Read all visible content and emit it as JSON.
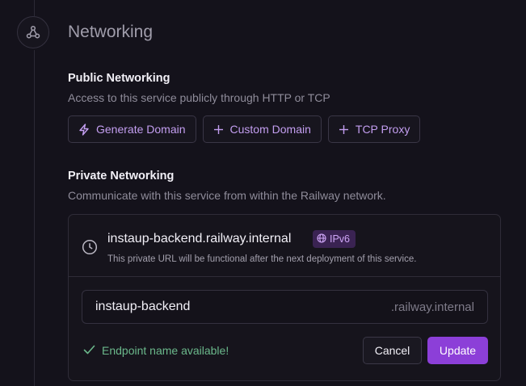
{
  "section": {
    "title": "Networking",
    "icon": "network-icon"
  },
  "public": {
    "title": "Public Networking",
    "description": "Access to this service publicly through HTTP or TCP",
    "buttons": [
      {
        "label": "Generate Domain",
        "icon": "lightning-icon"
      },
      {
        "label": "Custom Domain",
        "icon": "plus-icon"
      },
      {
        "label": "TCP Proxy",
        "icon": "plus-icon"
      }
    ]
  },
  "private": {
    "title": "Private Networking",
    "description": "Communicate with this service from within the Railway network.",
    "domain": "instaup-backend.railway.internal",
    "badge": "IPv6",
    "note": "This private URL will be functional after the next deployment of this service.",
    "endpoint_value": "instaup-backend",
    "endpoint_suffix": ".railway.internal",
    "status": "Endpoint name available!",
    "cancel_label": "Cancel",
    "update_label": "Update"
  },
  "colors": {
    "accent": "#8c3fd8",
    "accent_text": "#c39ef0",
    "success": "#6bb88b",
    "background": "#14121b"
  }
}
